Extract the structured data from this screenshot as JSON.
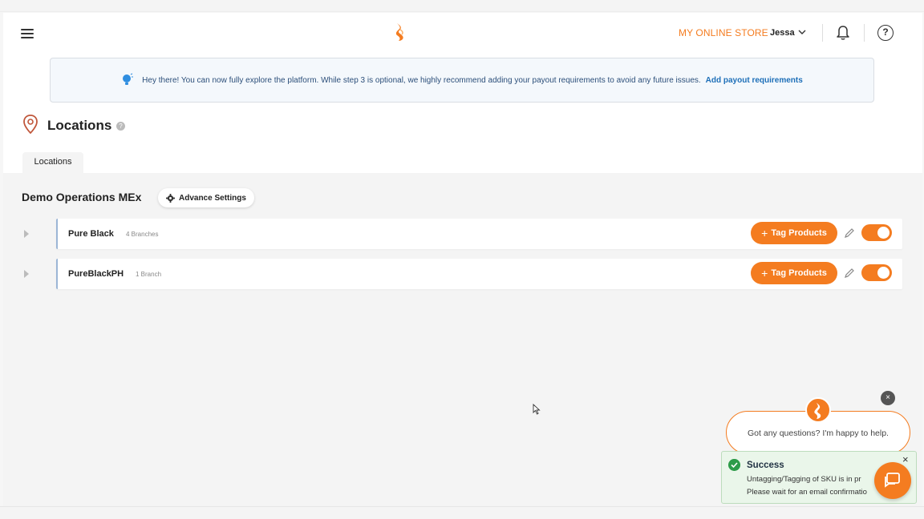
{
  "header": {
    "store_name": "MY ONLINE STORE",
    "user_name": "Jessa",
    "icons": {
      "menu": "hamburger-menu-icon",
      "logo": "brand-logo-icon",
      "user_dropdown": "chevron-down-icon",
      "notifications": "bell-icon",
      "help": "help-question-icon"
    },
    "help_glyph": "?",
    "accent_color": "#f47c20"
  },
  "banner": {
    "icon": "lightbulb-icon",
    "text": "Hey there! You can now fully explore the platform. While step 3 is optional, we highly recommend adding your payout requirements to avoid any future issues.",
    "link_label": "Add payout requirements"
  },
  "page": {
    "title": "Locations",
    "title_icon": "location-pin-icon",
    "info_glyph": "?",
    "tab_label": "Locations"
  },
  "operation": {
    "name": "Demo Operations MEx",
    "advance_settings_label": "Advance Settings",
    "brands": [
      {
        "name": "Pure Black",
        "branch_count": "4 Branches",
        "tag_label": "Tag Products",
        "enabled": true
      },
      {
        "name": "PureBlackPH",
        "branch_count": "1 Branch",
        "tag_label": "Tag Products",
        "enabled": true
      }
    ]
  },
  "chat": {
    "close_glyph": "×",
    "greeting": "Got any questions? I'm happy to help."
  },
  "toast": {
    "title": "Success",
    "message_line1": "Untagging/Tagging of SKU is in pr",
    "message_line2": "Please wait for an email confirmatio",
    "close_glyph": "×",
    "status_color": "#2e9c4a"
  }
}
